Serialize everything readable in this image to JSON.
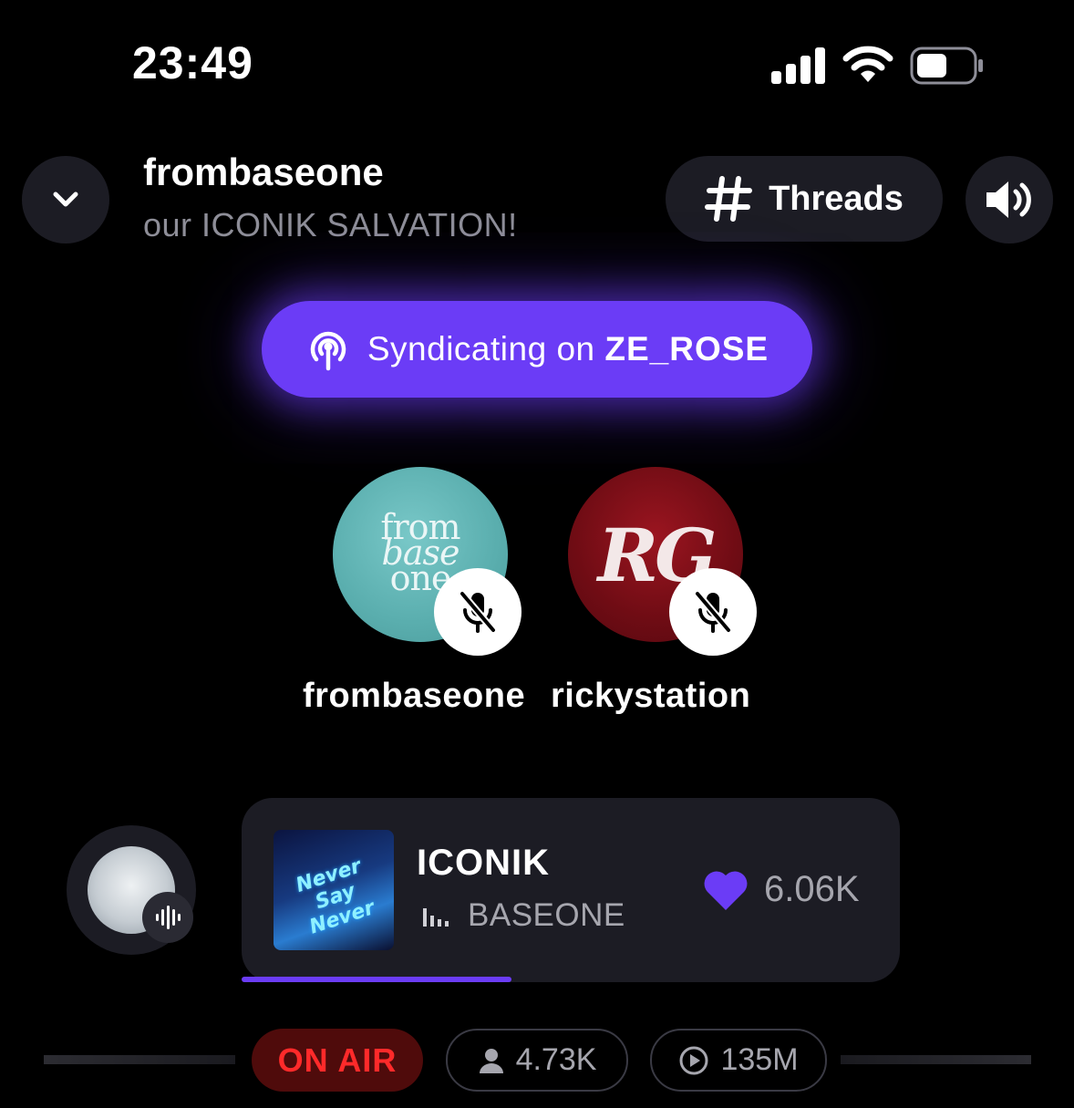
{
  "status_bar": {
    "time": "23:49",
    "icons": [
      "cellular-signal-icon",
      "wifi-icon",
      "battery-icon"
    ]
  },
  "header": {
    "title": "frombaseone",
    "subtitle": "our ICONIK SALVATION!",
    "threads_label": "Threads",
    "icons": [
      "chevron-down-icon",
      "hash-icon",
      "speaker-icon"
    ]
  },
  "syndication": {
    "prefix": "Syndicating on",
    "channel": "ZE_ROSE",
    "icon": "podcast-broadcast-icon"
  },
  "speakers": [
    {
      "name": "frombaseone",
      "avatar_text": [
        "from",
        "base",
        "one"
      ],
      "muted": true
    },
    {
      "name": "rickystation",
      "avatar_text": [
        "RG"
      ],
      "muted": true
    }
  ],
  "now_playing": {
    "song": "ICONIK",
    "artist": "BASEONE",
    "likes": "6.06K",
    "progress": 0.41,
    "accent": "#6b3cf6",
    "album_text": "Never Say Never"
  },
  "stats": {
    "on_air": "ON AIR",
    "listeners": "4.73K",
    "plays": "135M"
  },
  "colors": {
    "background": "#000000",
    "surface": "#1c1c24",
    "accent": "#6b3cf6",
    "on_air_text": "#ff2a2a",
    "on_air_bg": "#4f0b0b"
  }
}
